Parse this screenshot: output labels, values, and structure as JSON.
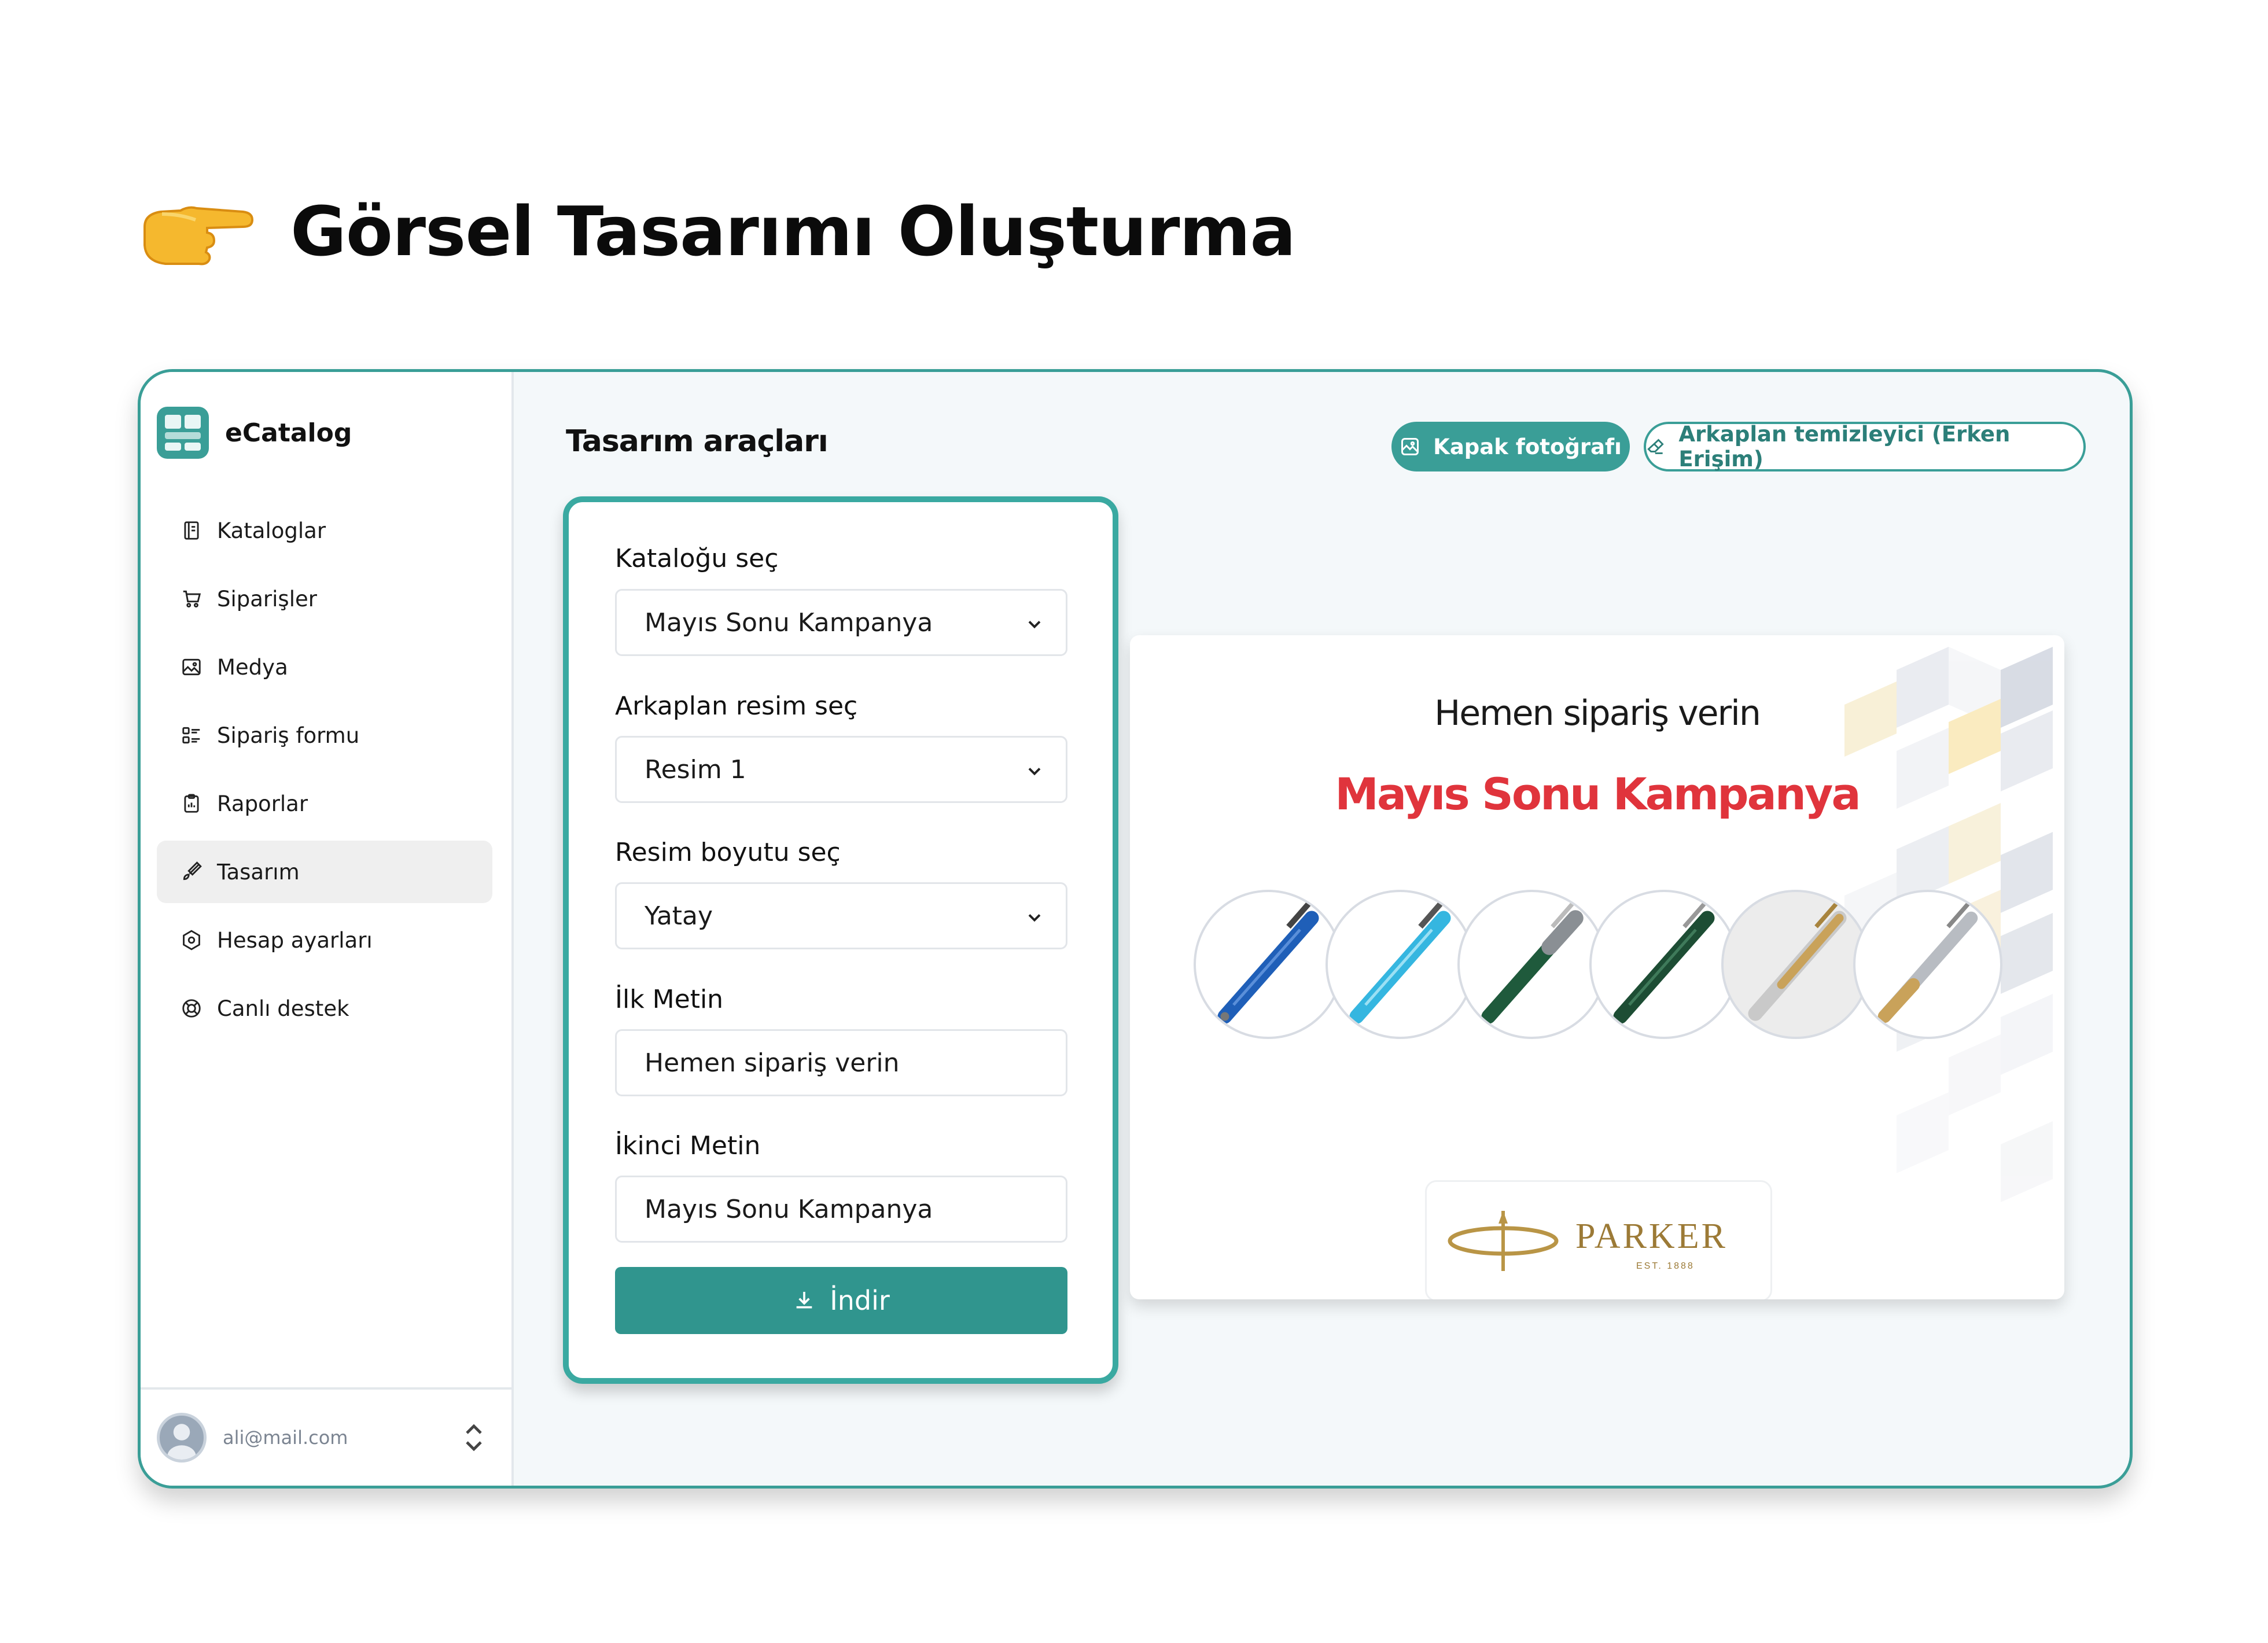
{
  "page": {
    "heading": "Görsel Tasarımı Oluşturma",
    "heading_icon": "pointing-hand-icon"
  },
  "sidebar": {
    "app_name": "eCatalog",
    "items": [
      {
        "label": "Kataloglar",
        "icon": "book-icon"
      },
      {
        "label": "Siparişler",
        "icon": "cart-icon"
      },
      {
        "label": "Medya",
        "icon": "image-icon"
      },
      {
        "label": "Sipariş formu",
        "icon": "form-list-icon"
      },
      {
        "label": "Raporlar",
        "icon": "clipboard-icon"
      },
      {
        "label": "Tasarım",
        "icon": "brush-icon",
        "active": true
      },
      {
        "label": "Hesap ayarları",
        "icon": "settings-hex-icon"
      },
      {
        "label": "Canlı destek",
        "icon": "lifebuoy-icon"
      }
    ],
    "user_email": "ali@mail.com"
  },
  "main": {
    "title": "Tasarım araçları",
    "cover_photo_button": "Kapak fotoğrafı",
    "background_remover_button": "Arkaplan temizleyici (Erken Erişim)"
  },
  "form": {
    "catalog_label": "Kataloğu seç",
    "catalog_value": "Mayıs Sonu Kampanya",
    "background_label": "Arkaplan resim seç",
    "background_value": "Resim 1",
    "size_label": "Resim boyutu seç",
    "size_value": "Yatay",
    "first_text_label": "İlk Metin",
    "first_text_value": "Hemen sipariş verin",
    "second_text_label": "İkinci Metin",
    "second_text_value": "Mayıs Sonu Kampanya",
    "download_button": "İndir"
  },
  "preview": {
    "line1": "Hemen sipariş verin",
    "line2": "Mayıs Sonu Kampanya",
    "line2_color": "#e0343c",
    "brand_name": "PARKER",
    "brand_subtitle": "EST. 1888",
    "pens": [
      {
        "color": "#1f5fb8"
      },
      {
        "color": "#35b6e0"
      },
      {
        "color": "#1f5a3c"
      },
      {
        "color": "#1d4d34"
      },
      {
        "color": "#c9a25a"
      },
      {
        "color": "#b8bcc2"
      }
    ]
  },
  "colors": {
    "accent": "#3a9e97",
    "button": "#30958e"
  }
}
